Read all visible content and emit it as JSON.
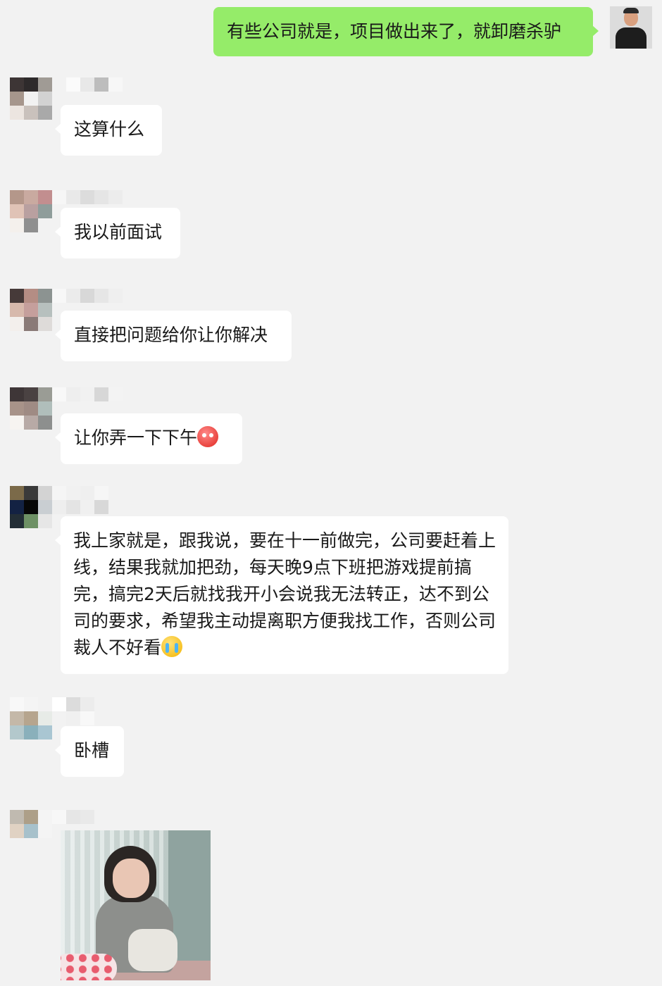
{
  "theme": {
    "background": "#f2f2f2",
    "bubble_in": "#ffffff",
    "bubble_out": "#95ec69",
    "text": "#191919"
  },
  "messages": [
    {
      "side": "out",
      "text": "有些公司就是，项目做出来了，就卸磨杀驴"
    },
    {
      "side": "in",
      "text": "这算什么"
    },
    {
      "side": "in",
      "text": "我以前面试"
    },
    {
      "side": "in",
      "text": "直接把问题给你让你解决"
    },
    {
      "side": "in",
      "text": "让你弄一下下午",
      "emoji": "angry-face-emoji"
    },
    {
      "side": "in",
      "text": "我上家就是，跟我说，要在十一前做完，公司要赶着上线，结果我就加把劲，每天晚9点下班把游戏提前搞完，搞完2天后就找我开小会说我无法转正，达不到公司的要求，希望我主动提离职方便我找工作，否则公司裁人不好看",
      "emoji": "crying-face-emoji"
    },
    {
      "side": "in",
      "text": "卧槽"
    },
    {
      "side": "in",
      "type": "image",
      "description": "crying-girl-sticker"
    }
  ]
}
